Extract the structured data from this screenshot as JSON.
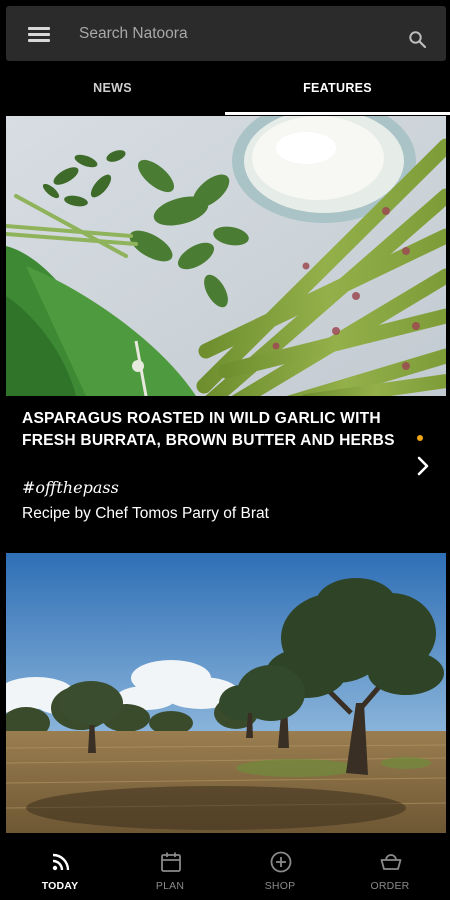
{
  "search": {
    "placeholder": "Search Natoora"
  },
  "tabs": [
    {
      "label": "NEWS",
      "active": false
    },
    {
      "label": "FEATURES",
      "active": true
    }
  ],
  "feature_cards": [
    {
      "title": "ASPARAGUS ROASTED IN WILD GARLIC WITH FRESH BURRATA, BROWN BUTTER AND HERBS",
      "hashtag": "#offthepass",
      "subtitle": "Recipe by Chef Tomos Parry of Brat",
      "unread": true,
      "image": "asparagus-burrata-herbs-photo"
    },
    {
      "image": "olive-trees-field-photo"
    }
  ],
  "bottom_nav": [
    {
      "label": "TODAY",
      "icon": "feed-icon",
      "active": true
    },
    {
      "label": "PLAN",
      "icon": "calendar-icon",
      "active": false
    },
    {
      "label": "SHOP",
      "icon": "plus-circle-icon",
      "active": false
    },
    {
      "label": "ORDER",
      "icon": "basket-icon",
      "active": false
    }
  ],
  "colors": {
    "background": "#000000",
    "search_bar": "#2b2b2b",
    "accent_dot": "#f0a716",
    "active_text": "#ffffff",
    "inactive_text": "#8a8a8a"
  }
}
